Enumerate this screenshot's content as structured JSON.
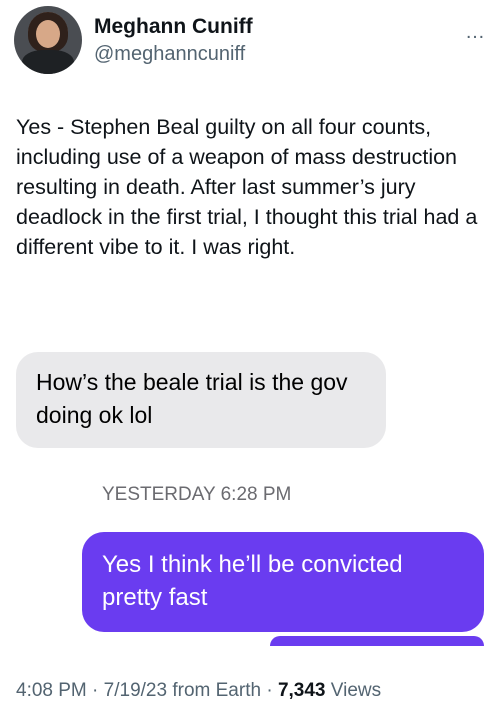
{
  "author": {
    "display_name": "Meghann Cuniff",
    "handle": "@meghanncuniff",
    "avatar_icon": "profile-photo"
  },
  "more_icon": "…",
  "tweet": {
    "text": "Yes - Stephen Beal guilty on all four counts, including use of a weapon of mass destruction resulting in death. After last summer’s jury deadlock in the first trial, I thought this trial had a different vibe to it. I was right."
  },
  "screenshot": {
    "incoming_message": "How’s the beale trial is the gov doing ok lol",
    "timestamp": "YESTERDAY 6:28 PM",
    "outgoing_message": "Yes I think he’ll be convicted pretty fast",
    "incoming_color": "#e9e9eb",
    "outgoing_color": "#6a3cf0"
  },
  "meta": {
    "time": "4:08 PM",
    "separator1": "·",
    "date": "7/19/23",
    "source": "from Earth",
    "separator2": "·",
    "views_count": "7,343",
    "views_label": "Views"
  }
}
